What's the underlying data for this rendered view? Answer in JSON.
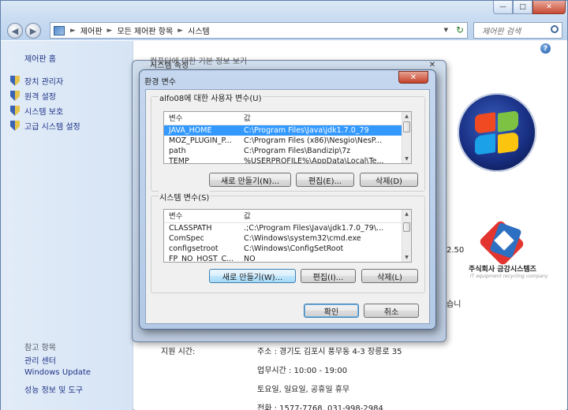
{
  "window": {
    "min_glyph": "—",
    "max_glyph": "□",
    "close_glyph": "✕"
  },
  "nav": {
    "back_glyph": "◀",
    "forward_glyph": "▶"
  },
  "address": {
    "sep": "►",
    "crumbs": [
      "제어판",
      "모든 제어판 항목",
      "시스템"
    ],
    "dropdown_glyph": "▼",
    "refresh_glyph": "↻"
  },
  "search": {
    "placeholder": "제어판 검색"
  },
  "left_pane": {
    "home": "제어판 홈",
    "tasks": [
      "장치 관리자",
      "원격 설정",
      "시스템 보호",
      "고급 시스템 설정"
    ],
    "see_also": "참고 항목",
    "links": [
      "관리 센터",
      "Windows Update",
      "성능 정보 및 도구"
    ]
  },
  "main": {
    "help_glyph": "?",
    "version_fragment": "2.50",
    "support_fragment": "습니",
    "oem_name": "주식회사 금강시스템즈",
    "oem_sub": "IT equipment recycling company",
    "support_hours_label": "지원 시간:",
    "address_line": "주소 : 경기도 김포시 풍무동 4-3 장릉로 35",
    "hours_line": "업무시간 : 10:00 - 19:00",
    "holiday_line": "토요일, 일요일, 공휴일 휴무",
    "phone_line": "전화 : 1577-7768, 031-998-2984"
  },
  "system_properties": {
    "title": "시스템 속성",
    "hidden_heading": "컴퓨터에 대한 기본 정보 보기",
    "close_glyph": "✕"
  },
  "env_dialog": {
    "title": "환경 변수",
    "close_glyph": "✕",
    "user_group_label": "alfo08에 대한 사용자 변수(U)",
    "system_group_label": "시스템 변수(S)",
    "col_variable": "변수",
    "col_value": "값",
    "user_vars": [
      {
        "name": "JAVA_HOME",
        "value": "C:\\Program Files\\Java\\jdk1.7.0_79"
      },
      {
        "name": "MOZ_PLUGIN_P...",
        "value": "C:\\Program Files (x86)\\Nesgio\\NesP..."
      },
      {
        "name": "path",
        "value": "C:\\Program Files\\Bandizip\\7z"
      },
      {
        "name": "TEMP",
        "value": "%USERPROFILE%\\AppData\\Local\\Te..."
      }
    ],
    "user_selected_index": 0,
    "system_vars": [
      {
        "name": "CLASSPATH",
        "value": ".;C:\\Program Files\\Java\\jdk1.7.0_79\\..."
      },
      {
        "name": "ComSpec",
        "value": "C:\\Windows\\system32\\cmd.exe"
      },
      {
        "name": "configsetroot",
        "value": "C:\\Windows\\ConfigSetRoot"
      },
      {
        "name": "FP_NO_HOST_C...",
        "value": "NO"
      }
    ],
    "user_buttons": {
      "new": "새로 만들기(N)...",
      "edit": "편집(E)...",
      "delete": "삭제(D)"
    },
    "system_buttons": {
      "new": "새로 만들기(W)...",
      "edit": "편집(I)...",
      "delete": "삭제(L)"
    },
    "ok": "확인",
    "cancel": "취소"
  },
  "colors": {
    "selection": "#3399ff",
    "link": "#1e3287",
    "close_red": "#c5412a"
  },
  "icons": [
    "back-icon",
    "forward-icon",
    "control-panel-icon",
    "refresh-icon",
    "search-icon",
    "shield-icon",
    "help-icon",
    "windows-logo",
    "oem-logo"
  ]
}
